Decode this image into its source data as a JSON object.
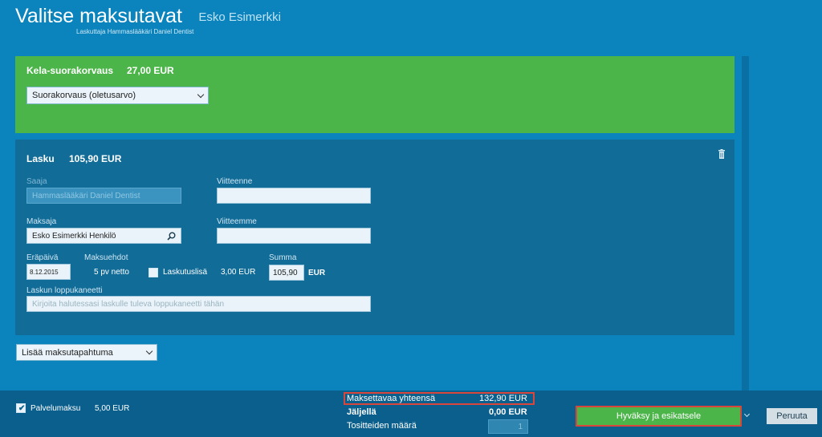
{
  "header": {
    "title": "Valitse maksutavat",
    "customer": "Esko Esimerkki",
    "subtitle": "Laskuttaja Hammaslääkäri Daniel Dentist"
  },
  "kela": {
    "title": "Kela-suorakorvaus",
    "amount": "27,00 EUR",
    "select_value": "Suorakorvaus (oletusarvo)"
  },
  "lasku": {
    "title": "Lasku",
    "amount": "105,90 EUR",
    "saaja_label": "Saaja",
    "saaja_value": "Hammaslääkäri Daniel Dentist",
    "viitteenne_label": "Viitteenne",
    "viitteenne_value": "",
    "maksaja_label": "Maksaja",
    "maksaja_value": "Esko Esimerkki Henkilö",
    "viitteemme_label": "Viitteemme",
    "viitteemme_value": "",
    "erapaiva_label": "Eräpäivä",
    "erapaiva_value": "8.12.2015",
    "maksuehdot_label": "Maksuehdot",
    "maksuehdot_value": "5 pv netto",
    "laskutuslisa_label": "Laskutuslisä",
    "laskutuslisa_value": "3,00 EUR",
    "summa_label": "Summa",
    "summa_value": "105,90",
    "summa_unit": "EUR",
    "loppukaneetti_label": "Laskun loppukaneetti",
    "loppukaneetti_placeholder": "Kirjoita halutessasi laskulle tuleva loppukaneetti tähän"
  },
  "add_payment": {
    "select_value": "Lisää maksutapahtuma"
  },
  "footer": {
    "palvelumaksu_label": "Palvelumaksu",
    "palvelumaksu_value": "5,00 EUR",
    "total_label": "Maksettavaa yhteensä",
    "total_value": "132,90 EUR",
    "remaining_label": "Jäljellä",
    "remaining_value": "0,00 EUR",
    "receipts_label": "Tositteiden määrä",
    "receipts_value": "1",
    "approve_label": "Hyväksy ja esikatsele",
    "cancel_label": "Peruuta"
  }
}
